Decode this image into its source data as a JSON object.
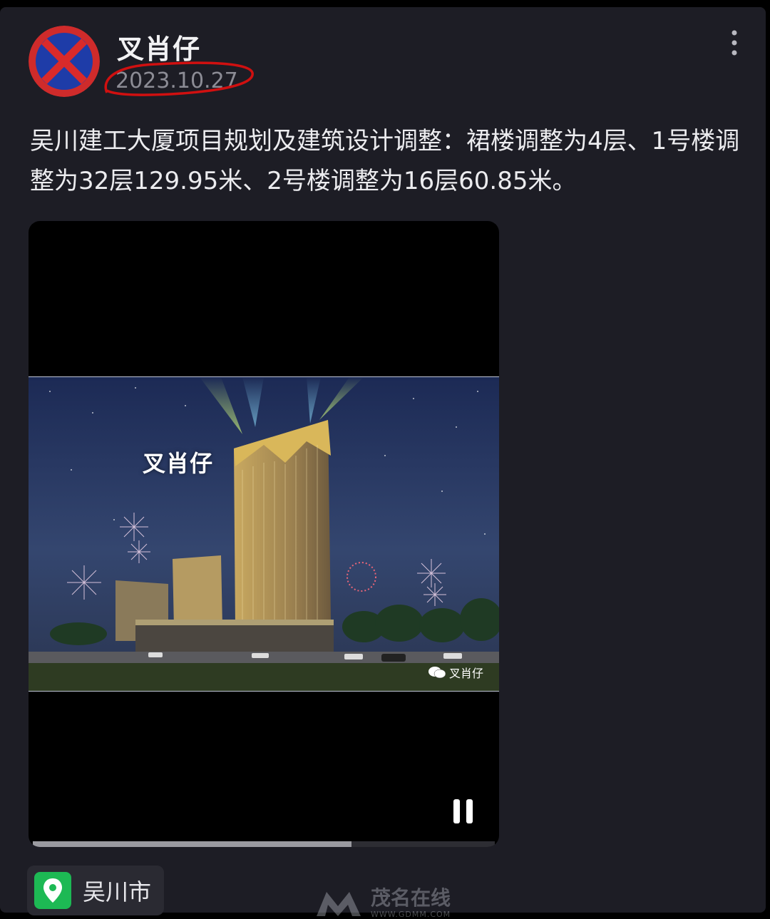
{
  "post": {
    "author": "叉肖仔",
    "date": "2023.10.27",
    "text": "吴川建工大厦项目规划及建筑设计调整：裙楼调整为4层、1号楼调整为32层129.95米、2号楼调整为16层60.85米。",
    "location": "吴川市"
  },
  "video": {
    "overlay_name": "叉肖仔",
    "watermark": "叉肖仔",
    "progress": 0.69,
    "state": "playing"
  },
  "icons": {
    "avatar": "no-parking-sign-icon",
    "more": "more-vertical-icon",
    "pause": "pause-icon",
    "location": "location-pin-icon",
    "watermark": "wechat-icon"
  },
  "site_watermark": {
    "name": "茂名在线",
    "url": "WWW.GDMM.COM"
  },
  "colors": {
    "background": "#1d1d25",
    "location_pin": "#1db954",
    "annotation": "#d01010"
  }
}
